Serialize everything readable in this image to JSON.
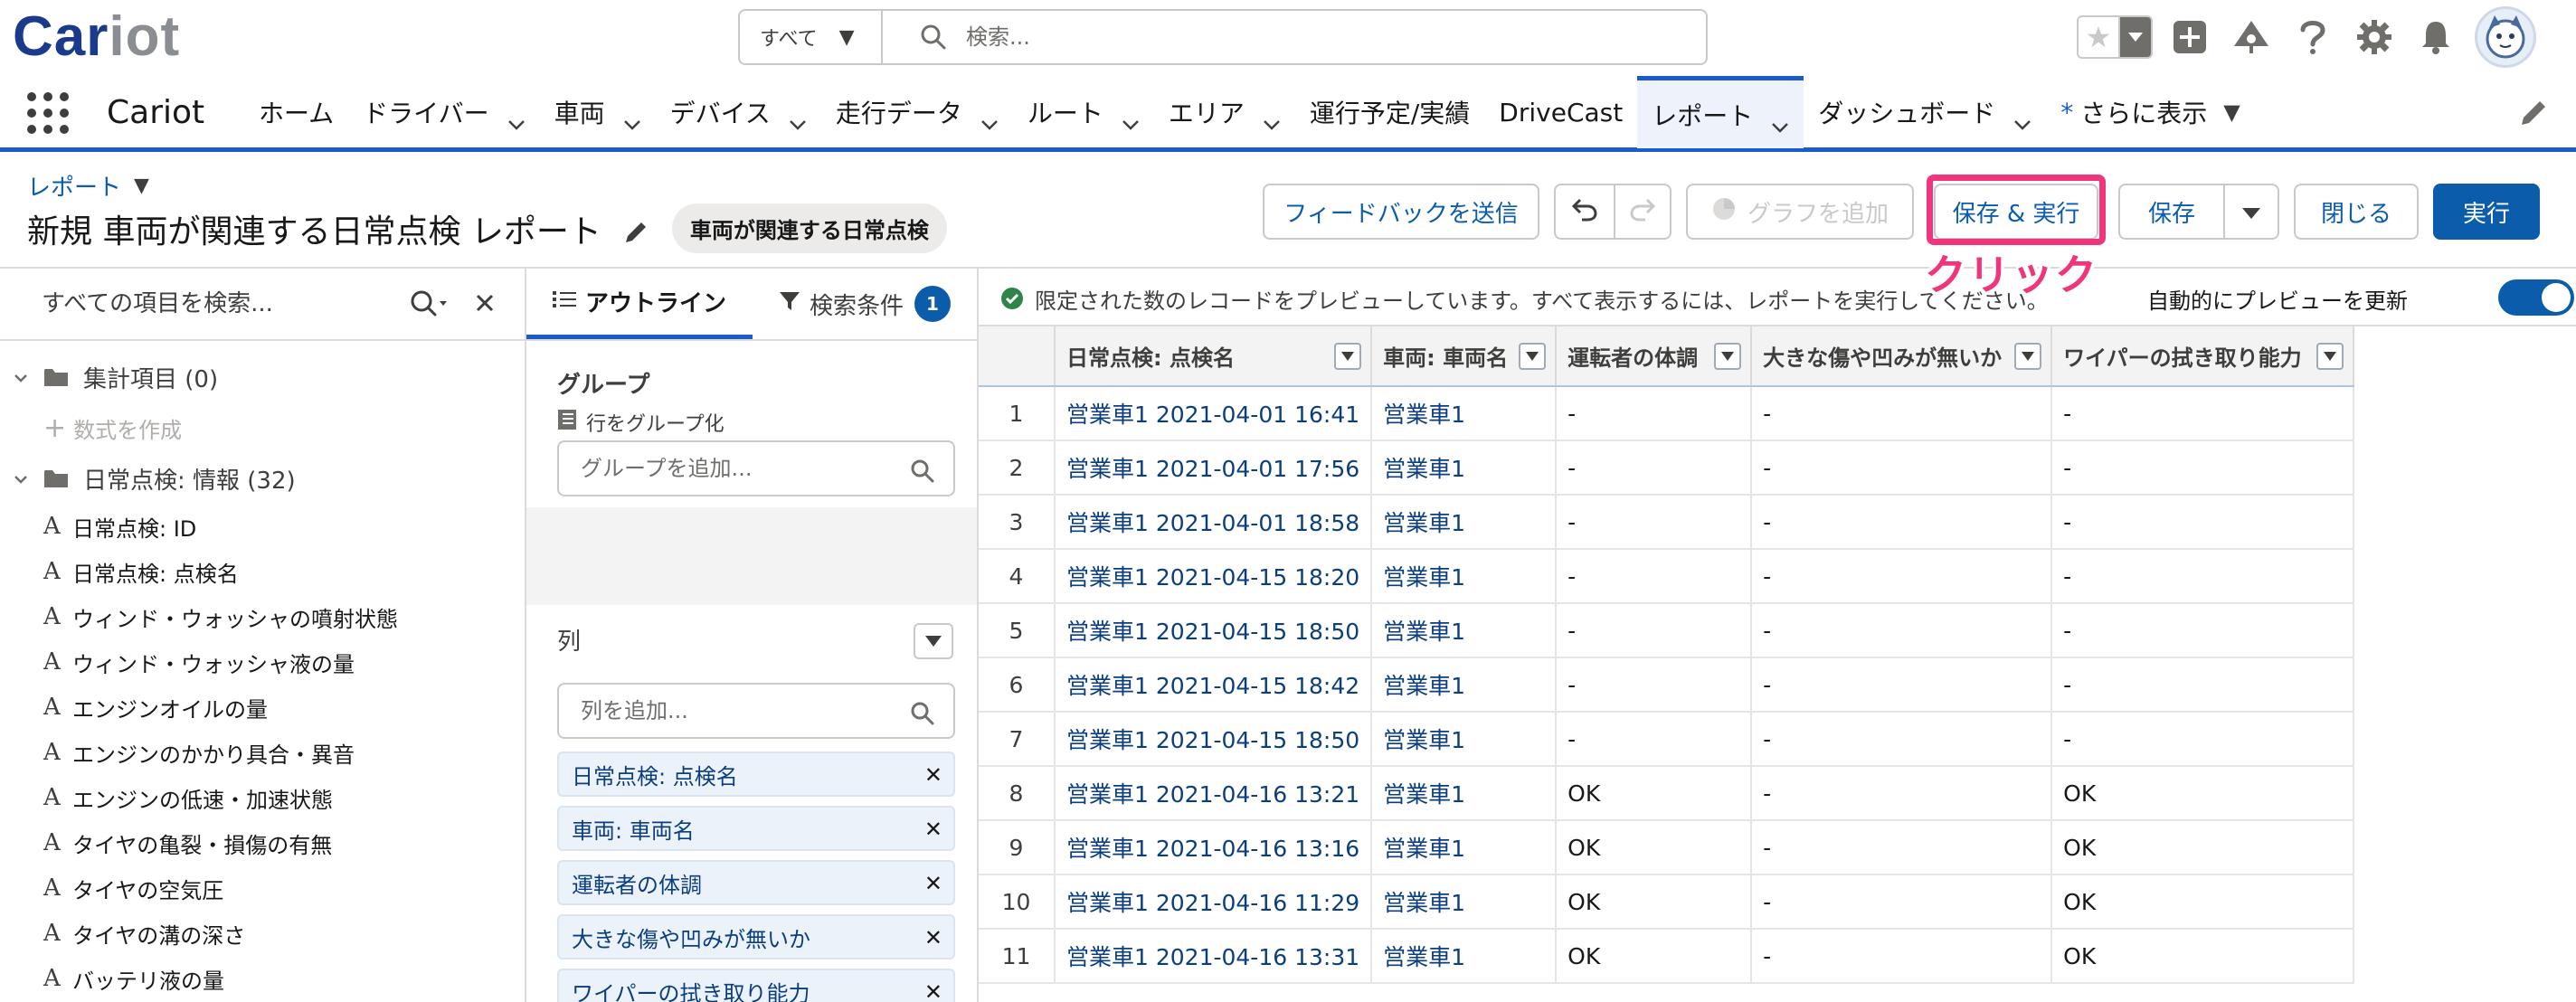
{
  "app": {
    "logo_text_1": "Car",
    "logo_text_2": "iot",
    "name": "Cariot"
  },
  "search": {
    "scope": "すべて",
    "placeholder": "検索..."
  },
  "nav": {
    "items": [
      {
        "label": "ホーム",
        "has_menu": false
      },
      {
        "label": "ドライバー",
        "has_menu": true
      },
      {
        "label": "車両",
        "has_menu": true
      },
      {
        "label": "デバイス",
        "has_menu": true
      },
      {
        "label": "走行データ",
        "has_menu": true
      },
      {
        "label": "ルート",
        "has_menu": true
      },
      {
        "label": "エリア",
        "has_menu": true
      },
      {
        "label": "運行予定/実績",
        "has_menu": false
      },
      {
        "label": "DriveCast",
        "has_menu": false
      },
      {
        "label": "レポート",
        "has_menu": true,
        "active": true
      },
      {
        "label": "ダッシュボード",
        "has_menu": true
      }
    ],
    "more_star": "*",
    "more_label": "さらに表示"
  },
  "report": {
    "type_label": "レポート",
    "title": "新規 車両が関連する日常点検 レポート",
    "report_type_badge": "車両が関連する日常点検",
    "buttons": {
      "feedback": "フィードバックを送信",
      "add_chart": "グラフを追加",
      "save_and_run": "保存 & 実行",
      "save": "保存",
      "close": "閉じる",
      "run": "実行"
    },
    "annotation": "クリック"
  },
  "fields_panel": {
    "search_placeholder": "すべての項目を検索...",
    "summary_folder": "集計項目 (0)",
    "add_formula": "数式を作成",
    "info_folder": "日常点検: 情報 (32)",
    "fields": [
      "日常点検: ID",
      "日常点検: 点検名",
      "ウィンド・ウォッシャの噴射状態",
      "ウィンド・ウォッシャ液の量",
      "エンジンオイルの量",
      "エンジンのかかり具合・異音",
      "エンジンの低速・加速状態",
      "タイヤの亀裂・損傷の有無",
      "タイヤの空気圧",
      "タイヤの溝の深さ",
      "バッテリ液の量"
    ]
  },
  "outline_panel": {
    "tab_outline": "アウトライン",
    "tab_filters": "検索条件",
    "filter_count": "1",
    "groups_heading": "グループ",
    "group_rows_label": "行をグループ化",
    "add_group_placeholder": "グループを追加...",
    "columns_heading": "列",
    "add_column_placeholder": "列を追加...",
    "columns": [
      "日常点検: 点検名",
      "車両: 車両名",
      "運転者の体調",
      "大きな傷や凹みが無いか",
      "ワイパーの拭き取り能力"
    ]
  },
  "preview": {
    "message": "限定された数のレコードをプレビューしています。すべて表示するには、レポートを実行してください。",
    "auto_update_label": "自動的にプレビューを更新",
    "auto_update_on": true,
    "headers": [
      "日常点検: 点検名",
      "車両: 車両名",
      "運転者の体調",
      "大きな傷や凹みが無いか",
      "ワイパーの拭き取り能力"
    ],
    "rows": [
      {
        "n": "1",
        "name": "営業車1 2021-04-01 16:41",
        "vehicle": "営業車1",
        "driver": "-",
        "damage": "-",
        "wiper": "-"
      },
      {
        "n": "2",
        "name": "営業車1 2021-04-01 17:56",
        "vehicle": "営業車1",
        "driver": "-",
        "damage": "-",
        "wiper": "-"
      },
      {
        "n": "3",
        "name": "営業車1 2021-04-01 18:58",
        "vehicle": "営業車1",
        "driver": "-",
        "damage": "-",
        "wiper": "-"
      },
      {
        "n": "4",
        "name": "営業車1 2021-04-15 18:20",
        "vehicle": "営業車1",
        "driver": "-",
        "damage": "-",
        "wiper": "-"
      },
      {
        "n": "5",
        "name": "営業車1 2021-04-15 18:50",
        "vehicle": "営業車1",
        "driver": "-",
        "damage": "-",
        "wiper": "-"
      },
      {
        "n": "6",
        "name": "営業車1 2021-04-15 18:42",
        "vehicle": "営業車1",
        "driver": "-",
        "damage": "-",
        "wiper": "-"
      },
      {
        "n": "7",
        "name": "営業車1 2021-04-15 18:50",
        "vehicle": "営業車1",
        "driver": "-",
        "damage": "-",
        "wiper": "-"
      },
      {
        "n": "8",
        "name": "営業車1 2021-04-16 13:21",
        "vehicle": "営業車1",
        "driver": "OK",
        "damage": "-",
        "wiper": "OK"
      },
      {
        "n": "9",
        "name": "営業車1 2021-04-16 13:16",
        "vehicle": "営業車1",
        "driver": "OK",
        "damage": "-",
        "wiper": "OK"
      },
      {
        "n": "10",
        "name": "営業車1 2021-04-16 11:29",
        "vehicle": "営業車1",
        "driver": "OK",
        "damage": "-",
        "wiper": "OK"
      },
      {
        "n": "11",
        "name": "営業車1 2021-04-16 13:31",
        "vehicle": "営業車1",
        "driver": "OK",
        "damage": "-",
        "wiper": "OK"
      }
    ]
  },
  "colors": {
    "brand": "#0b5cab",
    "nav_accent": "#1b5cc8",
    "highlight": "#f0357d",
    "logo_primary": "#1b3a8c",
    "logo_secondary": "#8a8d91"
  },
  "icons": {
    "search": "search-icon",
    "favorite": "star-icon",
    "add": "plus-icon",
    "trailhead": "trailhead-icon",
    "help": "help-icon",
    "setup": "gear-icon",
    "notifications": "bell-icon",
    "undo": "undo-icon",
    "redo": "redo-icon",
    "chart": "chart-icon",
    "folder": "folder-icon",
    "text_field": "text-field-icon",
    "check": "check-circle-icon"
  }
}
